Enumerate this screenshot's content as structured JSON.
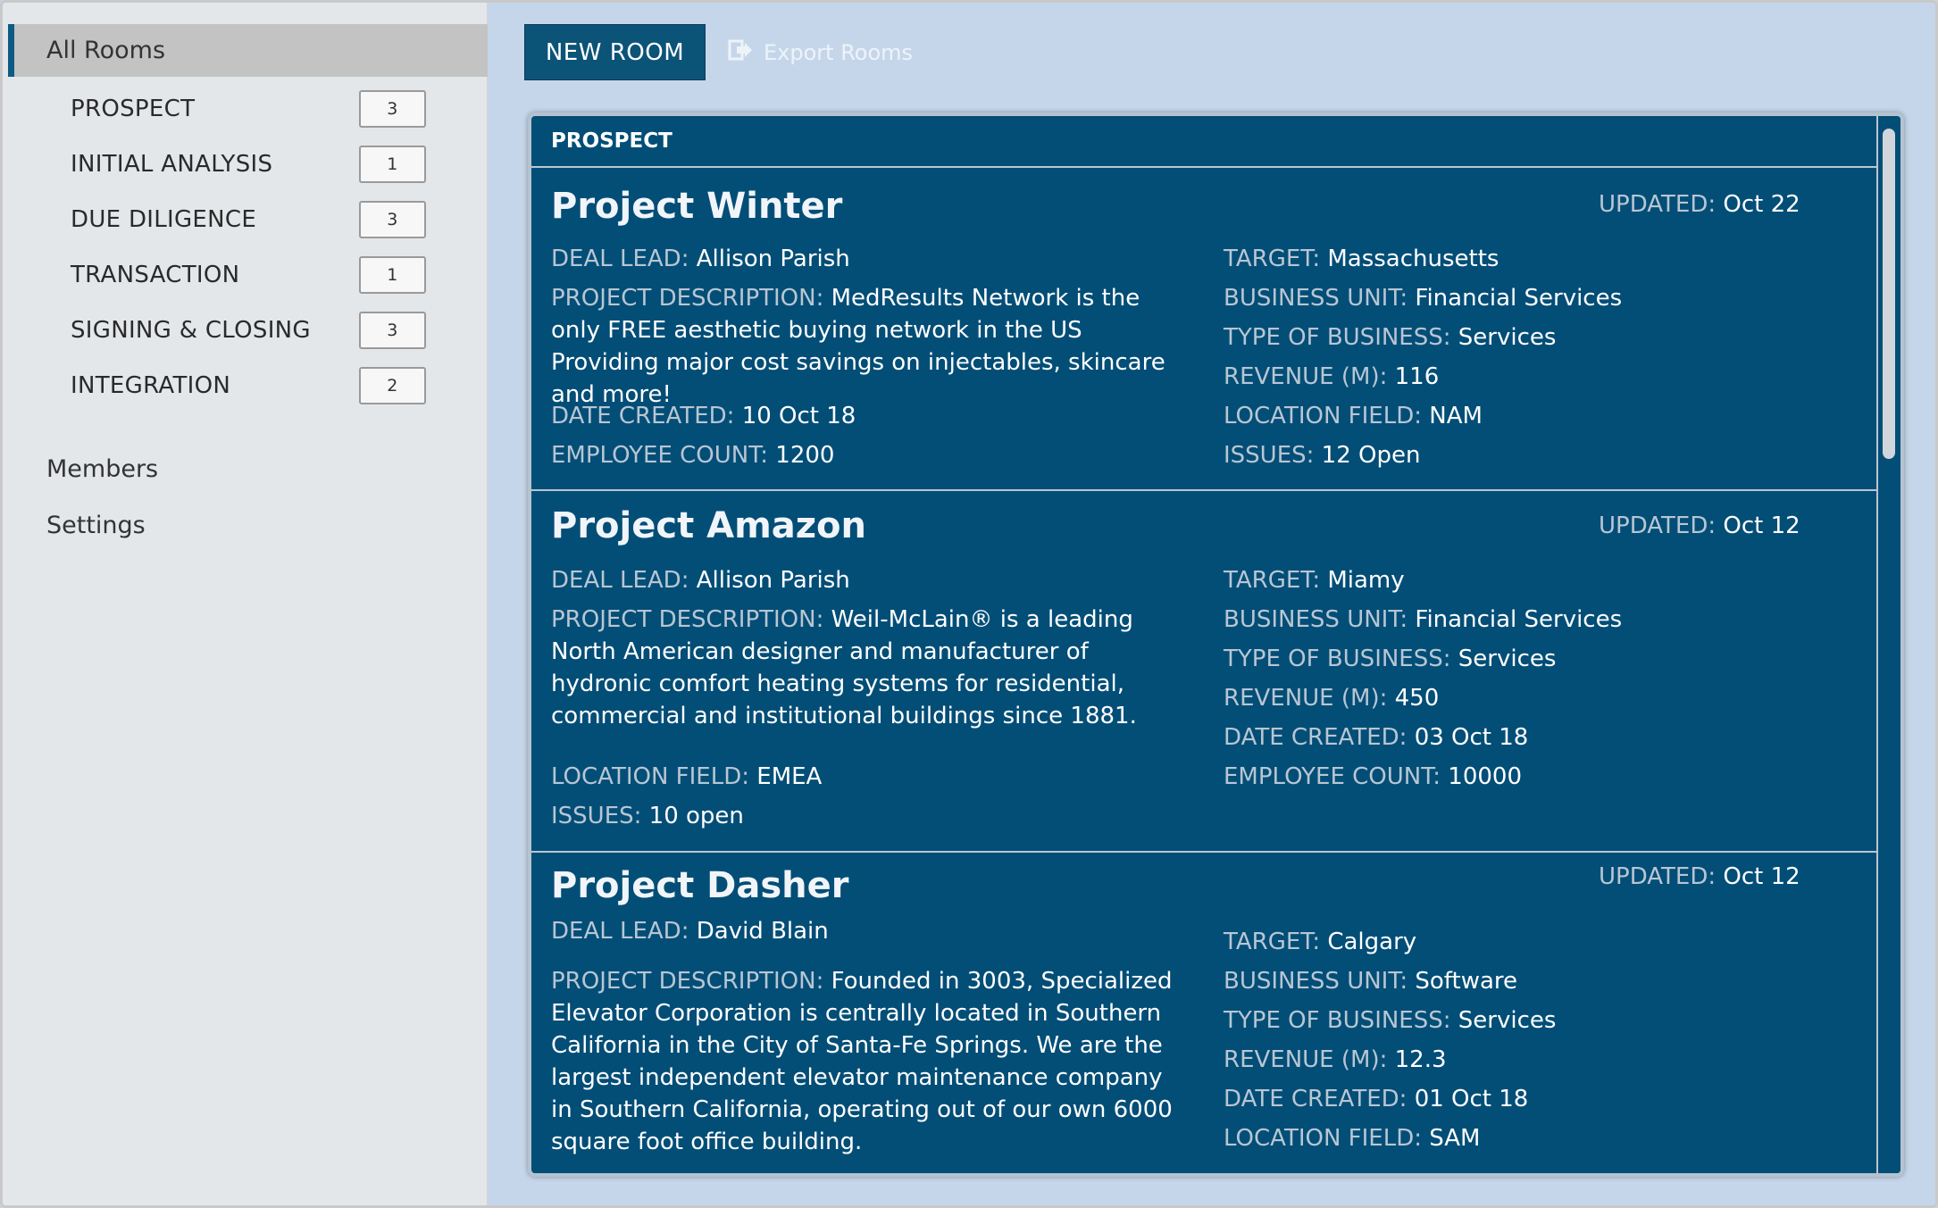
{
  "sidebar": {
    "all_rooms": "All Rooms",
    "stages": [
      {
        "label": "PROSPECT",
        "count": "3"
      },
      {
        "label": "INITIAL ANALYSIS",
        "count": "1"
      },
      {
        "label": "DUE DILIGENCE",
        "count": "3"
      },
      {
        "label": "TRANSACTION",
        "count": "1"
      },
      {
        "label": "SIGNING & CLOSING",
        "count": "3"
      },
      {
        "label": "INTEGRATION",
        "count": "2"
      }
    ],
    "members": "Members",
    "settings": "Settings"
  },
  "toolbar": {
    "new_room": "NEW ROOM",
    "export": "Export Rooms",
    "export_icon": "export-icon"
  },
  "panel": {
    "header": "PROSPECT",
    "labels": {
      "updated": "UPDATED:",
      "deal_lead": "DEAL LEAD:",
      "project_description": "PROJECT DESCRIPTION:",
      "date_created": "DATE CREATED:",
      "employee_count": "EMPLOYEE COUNT:",
      "target": "TARGET:",
      "business_unit": "BUSINESS UNIT:",
      "type_of_business": "TYPE OF BUSINESS:",
      "revenue": "REVENUE (M):",
      "location_field": "LOCATION FIELD:",
      "issues": "ISSUES:"
    },
    "rooms": [
      {
        "title": "Project Winter",
        "updated": "Oct 22",
        "deal_lead": "Allison Parish",
        "description_first": "MedResults Network is the only",
        "description_rest": "FREE aesthetic buying network in the US Providing major cost savings on injectables, skincare and more!",
        "date_created": "10 Oct 18",
        "employee_count": "1200",
        "target": "Massachusetts",
        "business_unit": "Financial Services",
        "type_of_business": "Services",
        "revenue": "116",
        "location_field": "NAM",
        "issues": "12 Open"
      },
      {
        "title": "Project Amazon",
        "updated": "Oct 12",
        "deal_lead": "Allison Parish",
        "description_first": "Weil-McLain® is a leading North",
        "description_rest": "American designer and manufacturer of hydronic comfort heating systems for residential, commercial and institutional buildings since 1881.",
        "location_field": "EMEA",
        "issues": "10 open",
        "target": "Miamy",
        "business_unit": "Financial Services",
        "type_of_business": "Services",
        "revenue": "450",
        "date_created": "03 Oct 18",
        "employee_count": "10000"
      },
      {
        "title": "Project Dasher",
        "updated": "Oct 12",
        "deal_lead": "David Blain",
        "description_first": "Founded in 3003, Specialized",
        "description_rest": "Elevator Corporation is centrally located in Southern California in the City of Santa-Fe Springs. We are the largest independent elevator maintenance company in Southern California, operating out of our own 6000 square foot office building.",
        "target": "Calgary",
        "business_unit": "Software",
        "type_of_business": "Services",
        "revenue": "12.3",
        "date_created": "01 Oct 18",
        "location_field": "SAM"
      }
    ]
  }
}
